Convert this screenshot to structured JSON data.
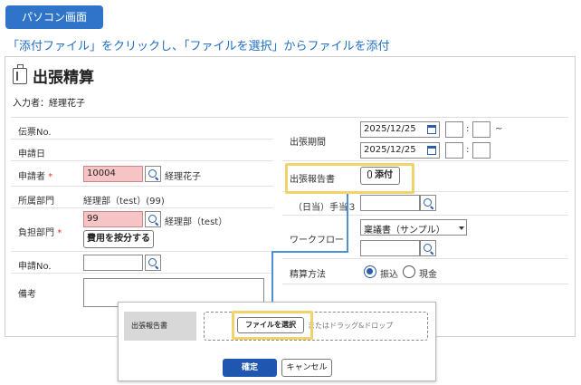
{
  "badge": "パソコン画面",
  "instruction": "「添付ファイル」をクリックし、「ファイルを選択」からファイルを添付",
  "page": {
    "title": "出張精算",
    "applicant": "入力者：経理花子"
  },
  "left": {
    "voucher_label": "伝票No.",
    "date_label": "申請日",
    "applicant_label": "申請者",
    "applicant_code": "10004",
    "applicant_name": "経理花子",
    "dept_label": "所属部門",
    "dept_value": "経理部（test）(99)",
    "burden_label": "負担部門",
    "burden_code": "99",
    "burden_name": "経理部（test）",
    "split_button": "費用を按分する",
    "appno_label": "申請No.",
    "note_label": "備考",
    "required_mark": "*"
  },
  "right": {
    "period_label": "出張期間",
    "period_start": "2025/12/25",
    "period_end": "2025/12/25",
    "colon": ":",
    "tilde": "~",
    "report_label": "出張報告書",
    "attach_button": "添付",
    "allowance_label": "（日当）手当３",
    "workflow_label": "ワークフロー",
    "workflow_value": "稟議書（サンプル）",
    "method_label": "精算方法",
    "method_options": [
      "振込",
      "現金"
    ],
    "method_selected": "振込"
  },
  "dialog": {
    "label": "出張報告書",
    "select_file": "ファイルを選択",
    "drop_text": "またはドラッグ&ドロップ",
    "ok": "確定",
    "cancel": "キャンセル"
  },
  "colors": {
    "accent": "#2f74c8",
    "instruction": "#1f6fc4",
    "highlight": "#f2d36b",
    "required_bg": "#f6c4c4",
    "primary_button": "#1e56b0"
  }
}
